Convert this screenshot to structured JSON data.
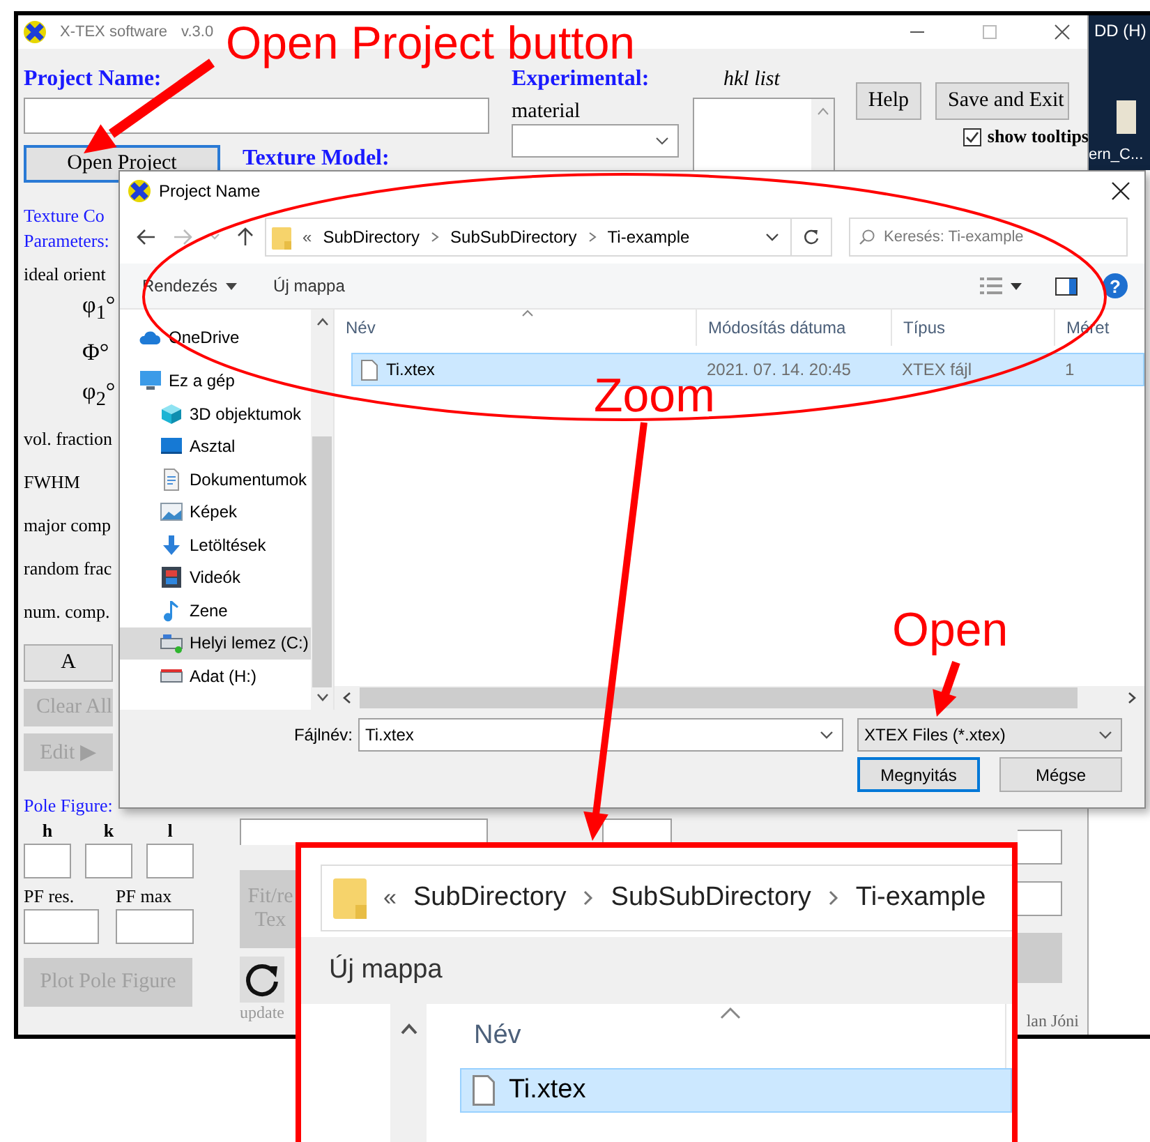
{
  "annotations": {
    "labels": [
      "Open Project button",
      "Zoom",
      "Open"
    ]
  },
  "desktop": {
    "drive_label": "DD (H)",
    "icon_label": "ern_C..."
  },
  "main_window": {
    "title": "X-TEX software",
    "version": "v.3.0",
    "project_name_label": "Project Name:",
    "open_project_button": "Open Project",
    "texture_model_label": "Texture Model:",
    "experimental_label": "Experimental:",
    "material_label": "material",
    "hkl_list_label": "hkl list",
    "help_button": "Help",
    "save_exit_button": "Save and Exit",
    "tooltips": {
      "label": "show tooltips",
      "checked": true
    },
    "section_labels": [
      "Texture Co",
      "Parameters:"
    ],
    "ideal_label": "ideal orient",
    "angles": [
      "φ$_{1}$°",
      "Φ°",
      "φ$_{2}$°"
    ],
    "param_labels": [
      "vol. fraction",
      "FWHM",
      "major comp",
      "random frac",
      "num. comp."
    ],
    "buttons": [
      {
        "label": "A",
        "disabled": false
      },
      {
        "label": "Clear All",
        "disabled": true
      },
      {
        "label": "Edit ▶",
        "disabled": true
      }
    ],
    "pole_figure": {
      "label": "Pole Figure:",
      "hkl_labels": [
        "h",
        "k",
        "l"
      ],
      "res_label": "PF res.",
      "max_label": "PF max",
      "plot_button": {
        "label": "Plot Pole Figure",
        "disabled": true
      }
    },
    "fit_button": {
      "lines": [
        "Fit/re",
        "Tex"
      ],
      "disabled": true
    },
    "update_label": "update",
    "credit": "lan Jóni"
  },
  "dialog": {
    "title": "Project Name",
    "overflow_mark": "«",
    "path": [
      "SubDirectory",
      "SubSubDirectory",
      "Ti-example"
    ],
    "search_placeholder": "Keresés: Ti-example",
    "organize": "Rendezés",
    "new_folder": "Új mappa",
    "help_glyph": "?",
    "nav_items": [
      {
        "label": "OneDrive",
        "kind": "cloud",
        "selected": false
      },
      {
        "label": "Ez a gép",
        "kind": "monitor",
        "selected": false,
        "children": [
          {
            "label": "3D objektumok",
            "kind": "cube",
            "selected": false
          },
          {
            "label": "Asztal",
            "kind": "desktop",
            "selected": false
          },
          {
            "label": "Dokumentumok",
            "kind": "document",
            "selected": false
          },
          {
            "label": "Képek",
            "kind": "picture",
            "selected": false
          },
          {
            "label": "Letöltések",
            "kind": "download",
            "selected": false
          },
          {
            "label": "Videók",
            "kind": "video",
            "selected": false
          },
          {
            "label": "Zene",
            "kind": "music",
            "selected": false
          },
          {
            "label": "Helyi lemez (C:)",
            "kind": "system_drive",
            "selected": true
          },
          {
            "label": "Adat (H:)",
            "kind": "drive",
            "selected": false
          }
        ]
      }
    ],
    "columns": [
      "Név",
      "Módosítás dátuma",
      "Típus",
      "Méret"
    ],
    "files": [
      {
        "name": "Ti.xtex",
        "modified": "2021. 07. 14. 20:45",
        "type": "XTEX fájl",
        "size": "1",
        "selected": true
      }
    ],
    "filename_label": "Fájlnév:",
    "filename": "Ti.xtex",
    "filter": "XTEX Files (*.xtex)",
    "open_button": "Megnyitás",
    "cancel_button": "Mégse"
  },
  "zoom_inset": {
    "overflow_mark": "«",
    "path": [
      "SubDirectory",
      "SubSubDirectory",
      "Ti-example"
    ],
    "new_folder": "Új mappa",
    "column": "Név",
    "file": {
      "name": "Ti.xtex",
      "selected": true
    }
  }
}
